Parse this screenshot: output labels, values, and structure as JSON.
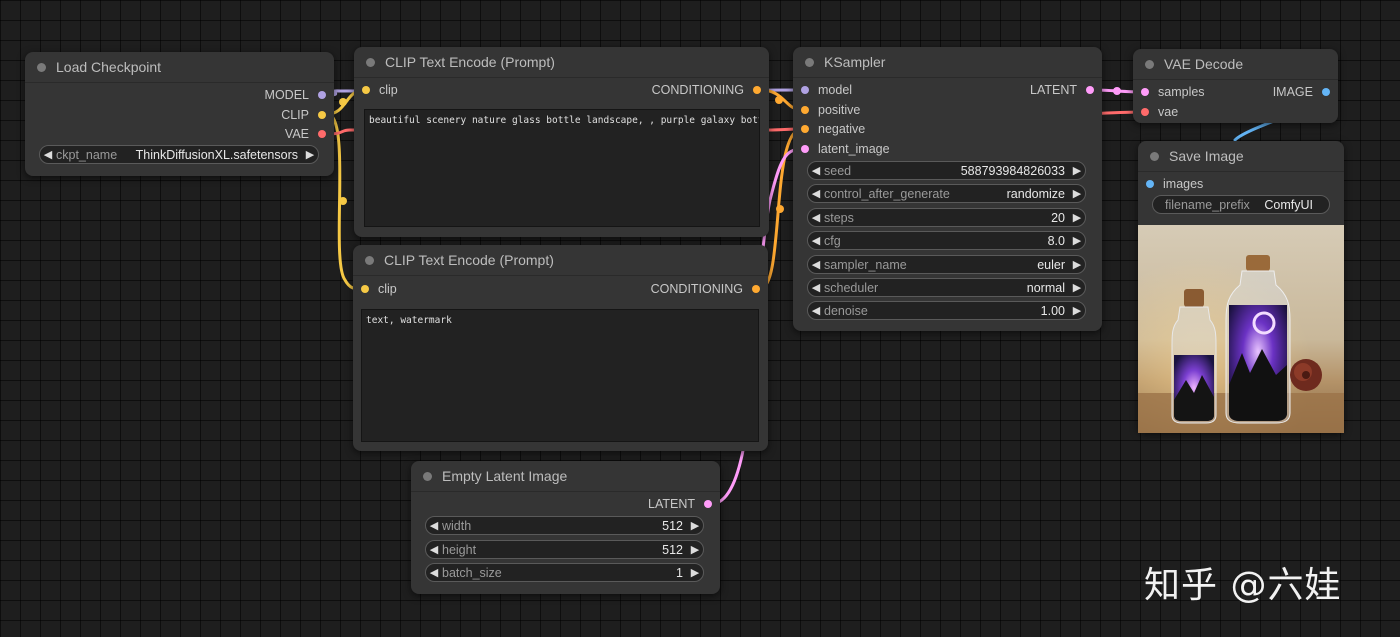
{
  "colors": {
    "model": "#b0a2e3",
    "clip": "#f6c945",
    "vae": "#ff6b6b",
    "conditioning": "#ffa931",
    "latent": "#ff9cf9",
    "image": "#64b5f6"
  },
  "load_checkpoint": {
    "title": "Load Checkpoint",
    "outputs": [
      "MODEL",
      "CLIP",
      "VAE"
    ],
    "ckpt": {
      "name": "ckpt_name",
      "value": "ThinkDiffusionXL.safetensors"
    }
  },
  "clip_positive": {
    "title": "CLIP Text Encode (Prompt)",
    "input": "clip",
    "output": "CONDITIONING",
    "text": "beautiful scenery nature glass bottle landscape, , purple galaxy bottle,"
  },
  "clip_negative": {
    "title": "CLIP Text Encode (Prompt)",
    "input": "clip",
    "output": "CONDITIONING",
    "text": "text, watermark"
  },
  "ksampler": {
    "title": "KSampler",
    "inputs": [
      "model",
      "positive",
      "negative",
      "latent_image"
    ],
    "output": "LATENT",
    "widgets": [
      {
        "name": "seed",
        "value": "588793984826033"
      },
      {
        "name": "control_after_generate",
        "value": "randomize"
      },
      {
        "name": "steps",
        "value": "20"
      },
      {
        "name": "cfg",
        "value": "8.0"
      },
      {
        "name": "sampler_name",
        "value": "euler"
      },
      {
        "name": "scheduler",
        "value": "normal"
      },
      {
        "name": "denoise",
        "value": "1.00"
      }
    ]
  },
  "vae_decode": {
    "title": "VAE Decode",
    "inputs": [
      "samples",
      "vae"
    ],
    "output": "IMAGE"
  },
  "save_image": {
    "title": "Save Image",
    "input": "images",
    "filename_prefix": {
      "name": "filename_prefix",
      "value": "ComfyUI"
    }
  },
  "empty_latent": {
    "title": "Empty Latent Image",
    "output": "LATENT",
    "widgets": [
      {
        "name": "width",
        "value": "512"
      },
      {
        "name": "height",
        "value": "512"
      },
      {
        "name": "batch_size",
        "value": "1"
      }
    ]
  },
  "watermark": "知乎 @六娃"
}
